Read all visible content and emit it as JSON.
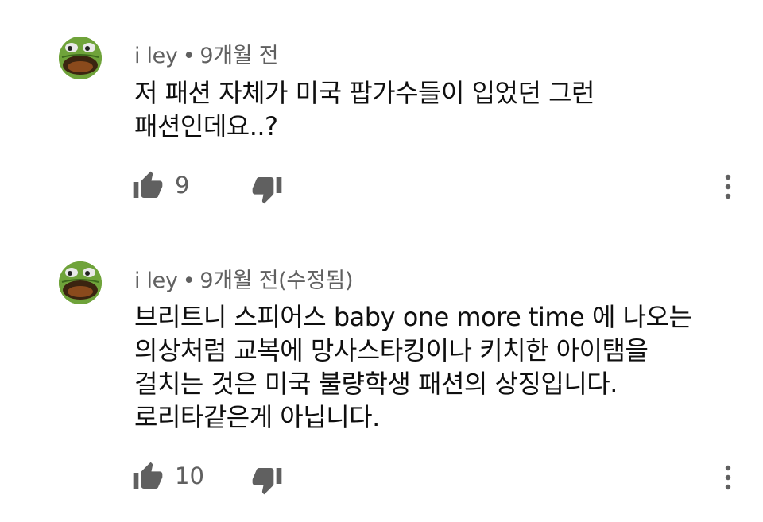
{
  "comments": [
    {
      "author": "i ley",
      "time": "9개월 전",
      "lines": [
        "저 패션 자체가 미국 팝가수들이 입었던 그런",
        "패션인데요..?"
      ],
      "likes": "9"
    },
    {
      "author": "i ley",
      "time": "9개월 전(수정됨)",
      "lines": [
        "브리트니 스피어스 baby one more time 에 나오는",
        "의상처럼 교복에 망사스타킹이나 키치한 아이탬을",
        "걸치는 것은 미국 불량학생 패션의 상징입니다.",
        "로리타같은게 아닙니다."
      ],
      "likes": "10"
    }
  ],
  "separator": "•",
  "icons": {
    "avatar": "frog-avatar",
    "like": "thumbs-up-icon",
    "dislike": "thumbs-down-icon",
    "more": "more-vert-icon"
  },
  "colors": {
    "text": "#0f0f0f",
    "meta": "#606060",
    "icon": "#606060",
    "avatar_green": "#6fa33a"
  }
}
